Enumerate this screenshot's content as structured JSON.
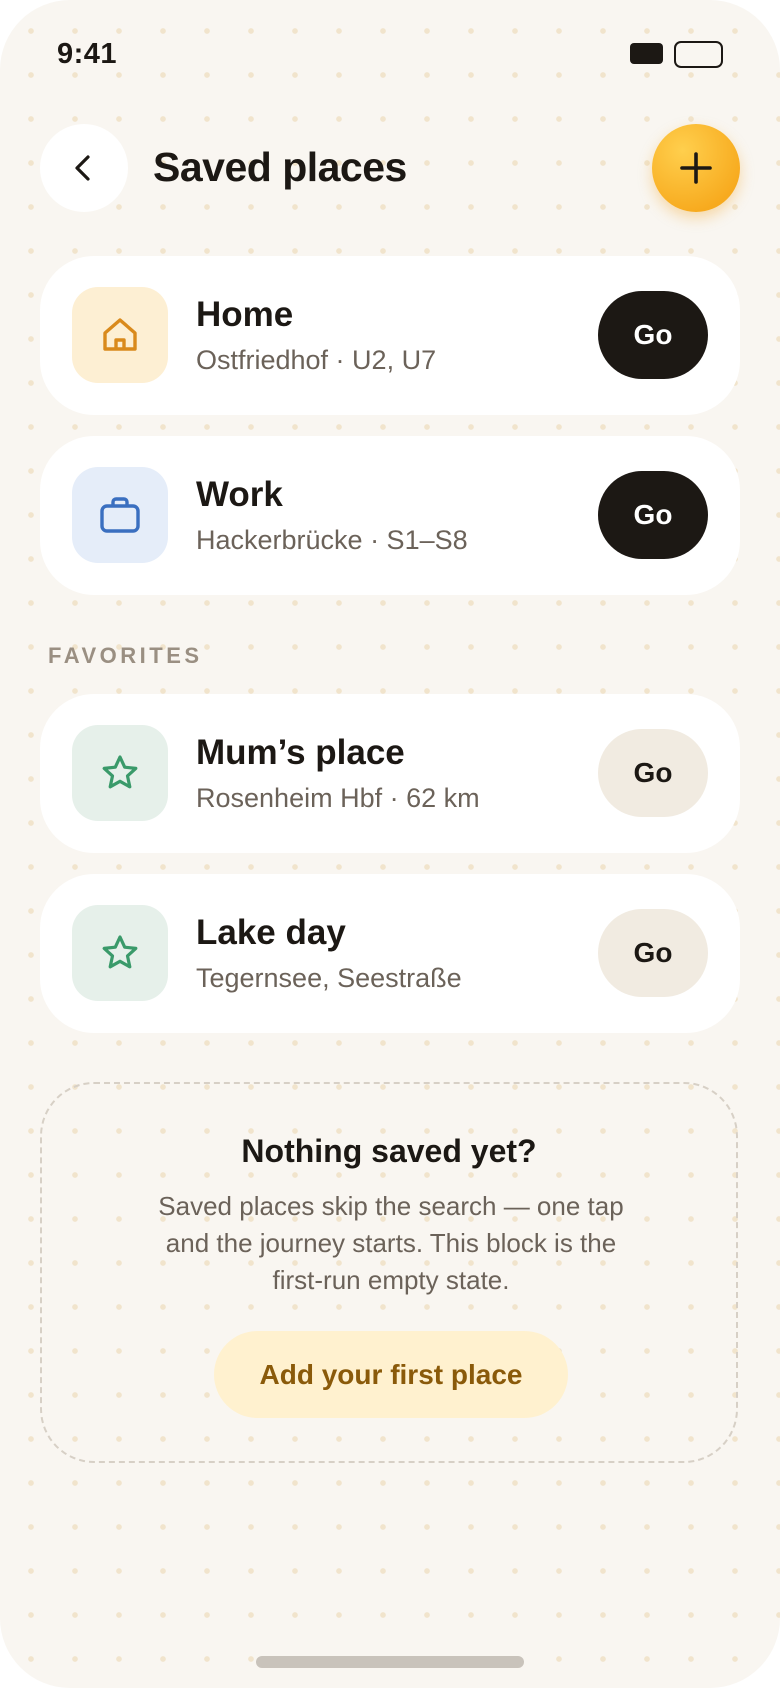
{
  "status_bar": {
    "time": "9:41"
  },
  "header": {
    "title": "Saved places"
  },
  "pinned": [
    {
      "title": "Home",
      "subtitle": "Ostfriedhof · U2, U7",
      "go_label": "Go",
      "icon": "house-icon"
    },
    {
      "title": "Work",
      "subtitle": "Hackerbrücke · S1–S8",
      "go_label": "Go",
      "icon": "briefcase-icon"
    }
  ],
  "favorites": {
    "section_label": "FAVORITES",
    "items": [
      {
        "title": "Mum’s place",
        "subtitle": "Rosenheim Hbf · 62 km",
        "go_label": "Go",
        "icon": "star-icon"
      },
      {
        "title": "Lake day",
        "subtitle": "Tegernsee, Seestraße",
        "go_label": "Go",
        "icon": "star-icon"
      }
    ]
  },
  "empty_state": {
    "title": "Nothing saved yet?",
    "body": "Saved places skip the search — one tap and the journey starts. This block is the first-run empty state.",
    "cta_label": "Add your first place"
  },
  "colors": {
    "background": "#f9f6f1",
    "accent": "#f7aa1e",
    "primary_button": "#1c1814",
    "home_icon": "#d98a1c",
    "work_icon": "#3a6fc0",
    "favorite_icon": "#3a9a6a"
  }
}
